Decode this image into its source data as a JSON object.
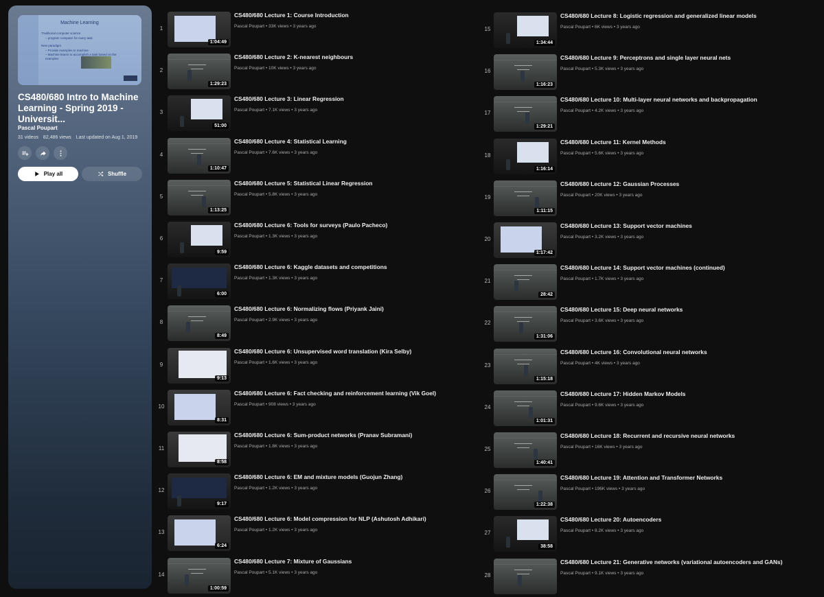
{
  "playlist": {
    "cover": {
      "slide_title": "Machine Learning",
      "bullets": [
        "Traditional computer science",
        "– program computer for every task",
        "New paradigm",
        "– Provide examples to machine",
        "– Machine learns to accomplish a task based on the",
        "examples"
      ]
    },
    "title": "CS480/680 Intro to Machine Learning - Spring 2019 - Universit...",
    "owner": "Pascal Poupart",
    "video_count": "31 videos",
    "views": "82,486 views",
    "updated": "Last updated on Aug 1, 2019",
    "actions": {
      "save_icon": "playlist-add-icon",
      "share_icon": "share-icon",
      "more_icon": "more-vert-icon"
    },
    "play_all_label": "Play all",
    "shuffle_label": "Shuffle"
  },
  "videos": [
    {
      "index": "1",
      "title": "CS480/680 Lecture 1: Course Introduction",
      "channel": "Pascal Poupart",
      "views": "33K views",
      "age": "3 years ago",
      "duration": "1:04:49"
    },
    {
      "index": "2",
      "title": "CS480/680 Lecture 2: K-nearest neighbours",
      "channel": "Pascal Poupart",
      "views": "10K views",
      "age": "3 years ago",
      "duration": "1:29:23"
    },
    {
      "index": "3",
      "title": "CS480/680 Lecture 3: Linear Regression",
      "channel": "Pascal Poupart",
      "views": "7.1K views",
      "age": "3 years ago",
      "duration": "51:00"
    },
    {
      "index": "4",
      "title": "CS480/680 Lecture 4: Statistical Learning",
      "channel": "Pascal Poupart",
      "views": "7.6K views",
      "age": "3 years ago",
      "duration": "1:10:47"
    },
    {
      "index": "5",
      "title": "CS480/680 Lecture 5: Statistical Linear Regression",
      "channel": "Pascal Poupart",
      "views": "5.8K views",
      "age": "3 years ago",
      "duration": "1:13:25"
    },
    {
      "index": "6",
      "title": "CS480/680 Lecture 6: Tools for surveys (Paulo Pacheco)",
      "channel": "Pascal Poupart",
      "views": "1.3K views",
      "age": "3 years ago",
      "duration": "9:59"
    },
    {
      "index": "7",
      "title": "CS480/680 Lecture 6: Kaggle datasets and competitions",
      "channel": "Pascal Poupart",
      "views": "1.3K views",
      "age": "3 years ago",
      "duration": "6:00"
    },
    {
      "index": "8",
      "title": "CS480/680 Lecture 6: Normalizing flows (Priyank Jaini)",
      "channel": "Pascal Poupart",
      "views": "2.9K views",
      "age": "3 years ago",
      "duration": "8:49"
    },
    {
      "index": "9",
      "title": "CS480/680 Lecture 6: Unsupervised word translation (Kira Selby)",
      "channel": "Pascal Poupart",
      "views": "1.6K views",
      "age": "3 years ago",
      "duration": "9:13"
    },
    {
      "index": "10",
      "title": "CS480/680 Lecture 6: Fact checking and reinforcement learning (Vik Goel)",
      "channel": "Pascal Poupart",
      "views": "908 views",
      "age": "3 years ago",
      "duration": "8:31"
    },
    {
      "index": "11",
      "title": "CS480/680 Lecture 6: Sum-product networks (Pranav Subramani)",
      "channel": "Pascal Poupart",
      "views": "1.8K views",
      "age": "3 years ago",
      "duration": "8:58"
    },
    {
      "index": "12",
      "title": "CS480/680 Lecture 6: EM and mixture models (Guojun Zhang)",
      "channel": "Pascal Poupart",
      "views": "1.2K views",
      "age": "3 years ago",
      "duration": "9:17"
    },
    {
      "index": "13",
      "title": "CS480/680 Lecture 6: Model compression for NLP (Ashutosh Adhikari)",
      "channel": "Pascal Poupart",
      "views": "1.2K views",
      "age": "3 years ago",
      "duration": "6:24"
    },
    {
      "index": "14",
      "title": "CS480/680 Lecture 7: Mixture of Gaussians",
      "channel": "Pascal Poupart",
      "views": "5.1K views",
      "age": "3 years ago",
      "duration": "1:00:59"
    },
    {
      "index": "15",
      "title": "CS480/680 Lecture 8: Logistic regression and generalized linear models",
      "channel": "Pascal Poupart",
      "views": "6K views",
      "age": "3 years ago",
      "duration": "1:34:44"
    },
    {
      "index": "16",
      "title": "CS480/680 Lecture 9: Perceptrons and single layer neural nets",
      "channel": "Pascal Poupart",
      "views": "5.3K views",
      "age": "3 years ago",
      "duration": "1:16:23"
    },
    {
      "index": "17",
      "title": "CS480/680 Lecture 10: Multi-layer neural networks and backpropagation",
      "channel": "Pascal Poupart",
      "views": "4.2K views",
      "age": "3 years ago",
      "duration": "1:29:21"
    },
    {
      "index": "18",
      "title": "CS480/680 Lecture 11: Kernel Methods",
      "channel": "Pascal Poupart",
      "views": "5.6K views",
      "age": "3 years ago",
      "duration": "1:16:14"
    },
    {
      "index": "19",
      "title": "CS480/680 Lecture 12: Gaussian Processes",
      "channel": "Pascal Poupart",
      "views": "20K views",
      "age": "3 years ago",
      "duration": "1:11:15"
    },
    {
      "index": "20",
      "title": "CS480/680 Lecture 13: Support vector machines",
      "channel": "Pascal Poupart",
      "views": "3.2K views",
      "age": "3 years ago",
      "duration": "1:17:42"
    },
    {
      "index": "21",
      "title": "CS480/680 Lecture 14: Support vector machines (continued)",
      "channel": "Pascal Poupart",
      "views": "1.7K views",
      "age": "3 years ago",
      "duration": "28:42"
    },
    {
      "index": "22",
      "title": "CS480/680 Lecture 15: Deep neural networks",
      "channel": "Pascal Poupart",
      "views": "3.6K views",
      "age": "3 years ago",
      "duration": "1:31:06"
    },
    {
      "index": "23",
      "title": "CS480/680 Lecture 16: Convolutional neural networks",
      "channel": "Pascal Poupart",
      "views": "4K views",
      "age": "3 years ago",
      "duration": "1:15:18"
    },
    {
      "index": "24",
      "title": "CS480/680 Lecture 17: Hidden Markov Models",
      "channel": "Pascal Poupart",
      "views": "9.6K views",
      "age": "3 years ago",
      "duration": "1:01:31"
    },
    {
      "index": "25",
      "title": "CS480/680 Lecture 18: Recurrent and recursive neural networks",
      "channel": "Pascal Poupart",
      "views": "16K views",
      "age": "3 years ago",
      "duration": "1:40:41"
    },
    {
      "index": "26",
      "title": "CS480/680 Lecture 19: Attention and Transformer Networks",
      "channel": "Pascal Poupart",
      "views": "196K views",
      "age": "3 years ago",
      "duration": "1:22:38"
    },
    {
      "index": "27",
      "title": "CS480/680 Lecture 20: Autoencoders",
      "channel": "Pascal Poupart",
      "views": "8.2K views",
      "age": "3 years ago",
      "duration": "38:58"
    },
    {
      "index": "28",
      "title": "CS480/680 Lecture 21: Generative networks (variational autoencoders and GANs)",
      "channel": "Pascal Poupart",
      "views": "9.1K views",
      "age": "3 years ago",
      "duration": ""
    }
  ]
}
